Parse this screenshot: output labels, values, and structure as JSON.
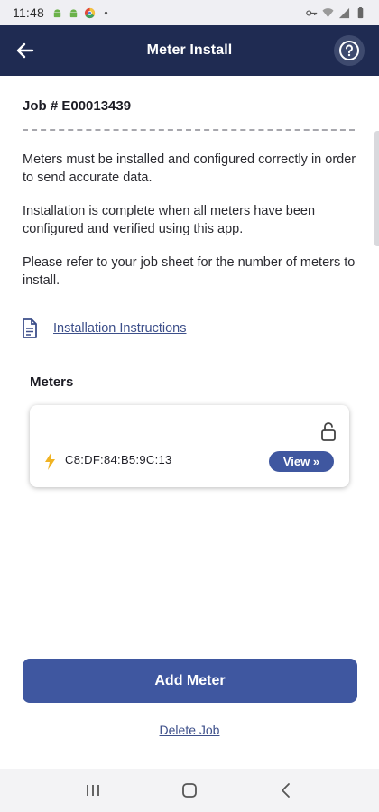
{
  "status_bar": {
    "time": "11:48",
    "icons_left": [
      "android-icon",
      "android-icon",
      "chrome-icon",
      "dot-icon"
    ],
    "icons_right": [
      "key-icon",
      "wifi-icon",
      "signal-icon",
      "battery-icon"
    ]
  },
  "app_bar": {
    "title": "Meter Install",
    "back_icon": "arrow-left-icon",
    "help_icon": "help-circle-icon"
  },
  "job": {
    "label": "Job # E00013439"
  },
  "body_text": {
    "p1": "Meters must be installed and configured correctly in order to send accurate data.",
    "p2": "Installation is complete when all meters have been configured and verified using this app.",
    "p3": "Please refer to your job sheet for the number of meters to install."
  },
  "instructions": {
    "icon": "document-icon",
    "link_label": "Installation Instructions"
  },
  "meters": {
    "heading": "Meters",
    "items": [
      {
        "id": "C8:DF:84:B5:9C:13",
        "lock_state": "unlocked",
        "view_label": "View »"
      }
    ]
  },
  "actions": {
    "add_meter_label": "Add Meter",
    "delete_job_label": "Delete Job"
  },
  "nav_bar": {
    "recents_icon": "recents-icon",
    "home_icon": "home-icon",
    "back_icon": "back-chevron-icon"
  },
  "colors": {
    "app_bar": "#1f2b52",
    "primary_button": "#3f57a0",
    "link": "#3d4f8a",
    "bolt": "#f0b323"
  }
}
